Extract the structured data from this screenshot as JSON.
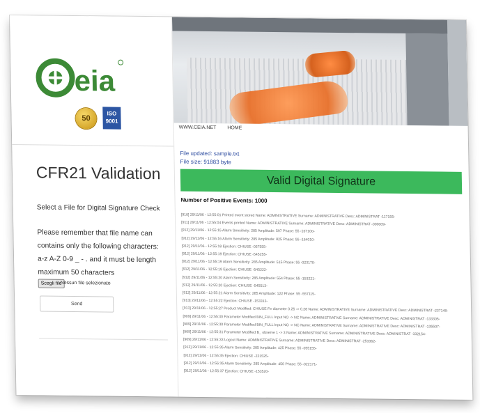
{
  "brand": {
    "logo_text": "CEIA",
    "anniversary_badge": "50",
    "iso_badge_lines": [
      "ISO",
      "9001"
    ]
  },
  "nav": {
    "items": [
      "WWW.CEIA.NET",
      "HOME"
    ]
  },
  "left_panel": {
    "title": "CFR21 Validation",
    "select_label": "Select a File for Digital Signature Check",
    "note": "Please remember that file name can contains only the following characters: a-z A-Z 0-9 _ - . and it must be length maximum 50 characters",
    "file_input": {
      "button_label": "Scegli file",
      "status": "Nessun file selezionato"
    },
    "submit_label": "Send"
  },
  "result": {
    "file_updated": "File updated: sample.txt",
    "file_size": "File size: 91883 byte",
    "banner": "Valid Digital Signature",
    "banner_color": "#3cb95c",
    "positive_events": "Number of Positive Events: 1000"
  },
  "log_lines": [
    "[910] 29/11/06 - 12:55:01 Printed event stored Name: ADMINISTRATIVE Surname: ADMINISTRATIVE Desc: ADMINISTRAT -117155-",
    "[911] 29/11/06 - 12:55:04 Events printed Name: ADMINISTRATIVE Surname: ADMINISTRATIVE Desc: ADMINISTRAT -000009-",
    "[912] 29/11/06 - 12:55:15 Alarm Sensitivity: 285 Amplitude: 597 Phase: 55 -167100-",
    "[912] 29/11/06 - 12:55:16 Alarm Sensitivity: 285 Amplitude: 825 Phase: 55 -164010-",
    "[912] 29/11/06 - 12:55:18 Ejection: CHIUSE -057555-",
    "[912] 29/11/06 - 12:55:19 Ejection: CHIUSE -545255-",
    "[912] 29/11/06 - 12:55:19 Alarm Sensitivity: 285 Amplitude: 515 Phase: 55 -023170-",
    "[912] 29/11/06 - 12:55:19 Ejection: CHIUSE -545222-",
    "[912] 29/11/06 - 12:55:20 Alarm Sensitivity: 285 Amplitude: 554 Phase: 55 -153221-",
    "[912] 29/11/06 - 12:55:20 Ejection: CHIUSE -545513-",
    "[912] 29/11/06 - 12:55:21 Alarm Sensitivity: 285 Amplitude: 122 Phase: 55 -557115-",
    "[913] 29/11/06 - 12:55:22 Ejection: CHIUSE -153313-",
    "[913] 29/11/06 - 12:55:27 Product Modified: CHIUSE Fe diameter 0.25 -> 0.28 Name: ADMINISTRATIVE Surname: ADMINISTRATIVE Desc: ADMINISTRAT -237148-",
    "[909] 29/11/06 - 12:55:30 Parameter Modified BIN_FULL Input NO -> NC Name: ADMINISTRATIVE Surname: ADMINISTRATIVE Desc: ADMINISTRAT -133305-",
    "[909] 29/11/06 - 12:55:30 Parameter Modified BIN_FULL Input NO -> NC Name: ADMINISTRATIVE Surname: ADMINISTRATIVE Desc: ADMINISTRAT -135507-",
    "[909] 29/11/06 - 12:55:31 Parameter Modified B_ observe 1 -> 3 Name: ADMINISTRATIVE Surname: ADMINISTRATIVE Desc: ADMINISTRAT -332154-",
    "[909] 29/11/06 - 12:55:33 Logout Name: ADMINISTRATIVE Surname: ADMINISTRATIVE Desc: ADMINISTRAT -253362-",
    "[912] 29/11/06 - 12:55:35 Alarm Sensitivity: 285 Amplitude: 425 Phase: 55 -055155-",
    "[912] 29/11/06 - 12:55:35 Ejection: CHIUSE -221525-",
    "[912] 29/11/06 - 12:55:35 Alarm Sensitivity: 285 Amplitude: 450 Phase: 55 -022171-",
    "[912] 29/11/06 - 12:55:37 Ejection: CHIUSE -153520-"
  ]
}
